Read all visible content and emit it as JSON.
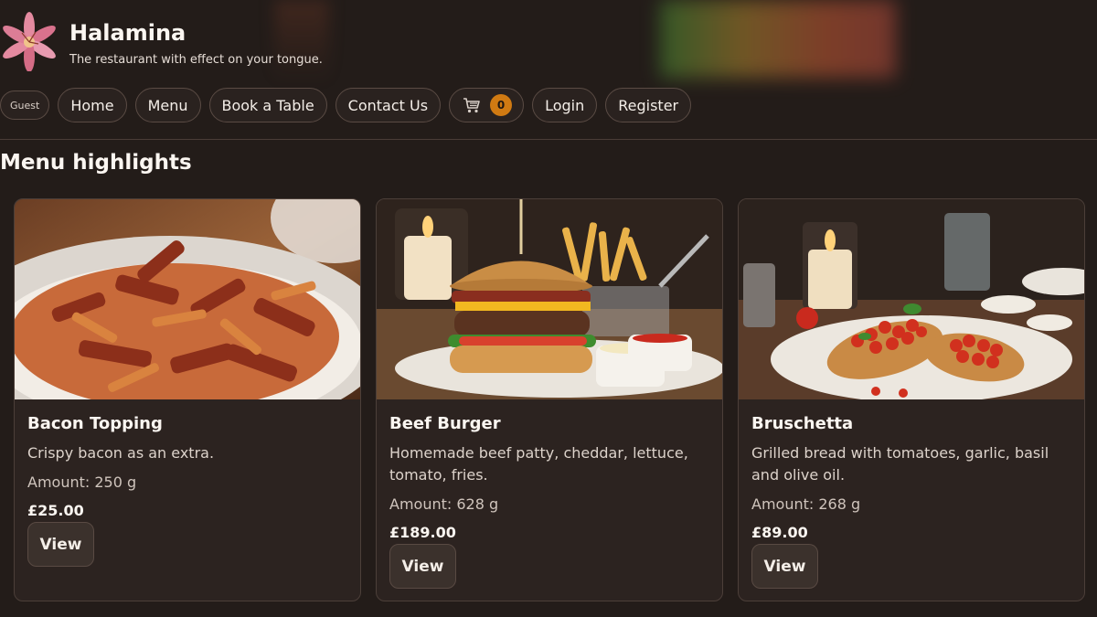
{
  "brand": {
    "name": "Halamina",
    "tagline": "The restaurant with effect on your tongue.",
    "logo_icon": "lily-flower-icon"
  },
  "nav": {
    "guest": "Guest",
    "home": "Home",
    "menu": "Menu",
    "book": "Book a Table",
    "contact": "Contact Us",
    "cart_icon": "shopping-cart-icon",
    "cart_count": "0",
    "login": "Login",
    "register": "Register"
  },
  "section_title": "Menu highlights",
  "colors": {
    "background": "#231c19",
    "card": "#2c2320",
    "badge": "#d07a12"
  },
  "items": [
    {
      "title": "Bacon Topping",
      "description": "Crispy bacon as an extra.",
      "amount": "Amount: 250 g",
      "price": "£25.00",
      "button": "View"
    },
    {
      "title": "Beef Burger",
      "description": "Homemade beef patty, cheddar, lettuce, tomato, fries.",
      "amount": "Amount: 628 g",
      "price": "£189.00",
      "button": "View"
    },
    {
      "title": "Bruschetta",
      "description": "Grilled bread with tomatoes, garlic, basil and olive oil.",
      "amount": "Amount: 268 g",
      "price": "£89.00",
      "button": "View"
    }
  ]
}
